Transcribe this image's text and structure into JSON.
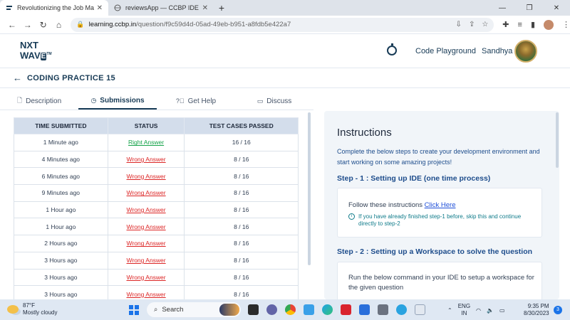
{
  "browser": {
    "tabs": [
      {
        "title": "Revolutionizing the Job Market |",
        "active": true
      },
      {
        "title": "reviewsApp — CCBP IDE",
        "active": false
      }
    ],
    "url_domain": "learning.ccbp.in",
    "url_path": "/question/f9c59d4d-05ad-49eb-b951-a8fdb5e422a7"
  },
  "header": {
    "logo_top": "NXT",
    "logo_bottom_prefix": "WAV",
    "logo_bottom_e": "E",
    "logo_tm": "TM",
    "code_playground": "Code Playground",
    "user_name": "Sandhya"
  },
  "practice": {
    "title": "CODING PRACTICE 15"
  },
  "left_tabs": [
    {
      "label": "Description",
      "icon": "document-icon"
    },
    {
      "label": "Submissions",
      "icon": "clock-icon"
    },
    {
      "label": "Get Help",
      "icon": "help-icon"
    },
    {
      "label": "Discuss",
      "icon": "chat-icon"
    }
  ],
  "submissions": {
    "headers": [
      "TIME SUBMITTED",
      "STATUS",
      "TEST CASES PASSED"
    ],
    "rows": [
      {
        "time": "1 Minute ago",
        "status": "Right Answer",
        "passed": "16 / 16",
        "kind": "right"
      },
      {
        "time": "4 Minutes ago",
        "status": "Wrong Answer",
        "passed": "8 / 16",
        "kind": "wrong"
      },
      {
        "time": "6 Minutes ago",
        "status": "Wrong Answer",
        "passed": "8 / 16",
        "kind": "wrong"
      },
      {
        "time": "9 Minutes ago",
        "status": "Wrong Answer",
        "passed": "8 / 16",
        "kind": "wrong"
      },
      {
        "time": "1 Hour ago",
        "status": "Wrong Answer",
        "passed": "8 / 16",
        "kind": "wrong"
      },
      {
        "time": "1 Hour ago",
        "status": "Wrong Answer",
        "passed": "8 / 16",
        "kind": "wrong"
      },
      {
        "time": "2 Hours ago",
        "status": "Wrong Answer",
        "passed": "8 / 16",
        "kind": "wrong"
      },
      {
        "time": "3 Hours ago",
        "status": "Wrong Answer",
        "passed": "8 / 16",
        "kind": "wrong"
      },
      {
        "time": "3 Hours ago",
        "status": "Wrong Answer",
        "passed": "8 / 16",
        "kind": "wrong"
      },
      {
        "time": "3 Hours ago",
        "status": "Wrong Answer",
        "passed": "8 / 16",
        "kind": "wrong"
      }
    ]
  },
  "instructions": {
    "title": "Instructions",
    "intro": "Complete the below steps to create your development environment and start working on some amazing projects!",
    "step1_title": "Step - 1 : Setting up IDE (one time process)",
    "step1_follow": "Follow these instructions",
    "step1_link": "Click Here",
    "step1_note": "If you have already finished step-1 before, skip this and continue directly to step-2",
    "step2_title": "Step - 2 : Setting up a Workspace to solve the question",
    "step2_text": "Run the below command in your IDE to setup a workspace for the given question"
  },
  "taskbar": {
    "temperature": "87°F",
    "weather": "Mostly cloudy",
    "search_label": "Search",
    "lang_top": "ENG",
    "lang_bottom": "IN",
    "time": "9:35 PM",
    "date": "8/30/2023",
    "notification_count": "3"
  },
  "colors": {
    "brand": "#183b56",
    "right": "#16a34a",
    "wrong": "#dc2626",
    "link": "#1d4ed8"
  }
}
